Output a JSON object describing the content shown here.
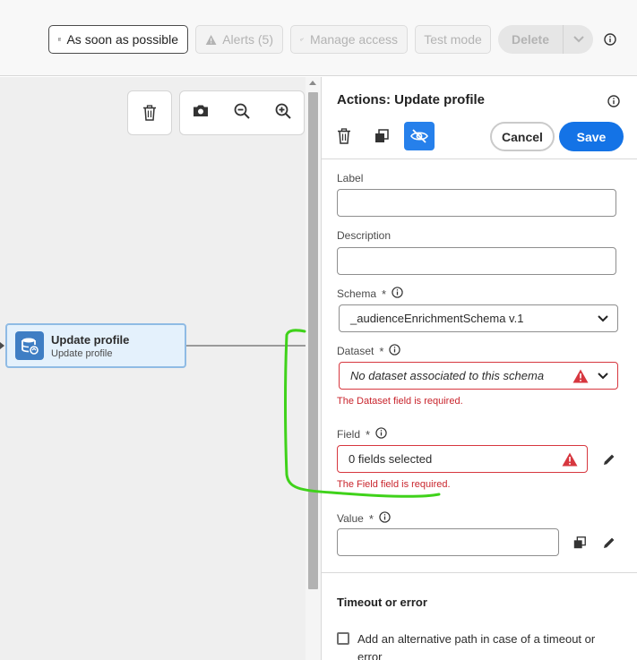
{
  "toolbar": {
    "schedule_label": "As soon as possible",
    "alerts_label": "Alerts (5)",
    "manage_access_label": "Manage access",
    "test_mode_label": "Test mode",
    "delete_label": "Delete"
  },
  "canvas": {
    "node": {
      "title": "Update profile",
      "subtitle": "Update profile"
    }
  },
  "panel": {
    "title": "Actions: Update profile",
    "cancel_label": "Cancel",
    "save_label": "Save",
    "fields": {
      "label": {
        "label": "Label",
        "value": ""
      },
      "description": {
        "label": "Description",
        "value": ""
      },
      "schema": {
        "label": "Schema",
        "required": "*",
        "value": "_audienceEnrichmentSchema v.1"
      },
      "dataset": {
        "label": "Dataset",
        "required": "*",
        "value": "No dataset associated to this schema",
        "error": "The Dataset field is required."
      },
      "field": {
        "label": "Field",
        "required": "*",
        "value": "0 fields selected",
        "error": "The Field field is required."
      },
      "value": {
        "label": "Value",
        "required": "*",
        "value": ""
      }
    },
    "timeout_section": {
      "title": "Timeout or error",
      "checkbox_label": "Add an alternative path in case of a timeout or error"
    }
  },
  "colors": {
    "primary": "#1473e6",
    "error": "#d7373f",
    "annotation": "#3fd21a"
  }
}
